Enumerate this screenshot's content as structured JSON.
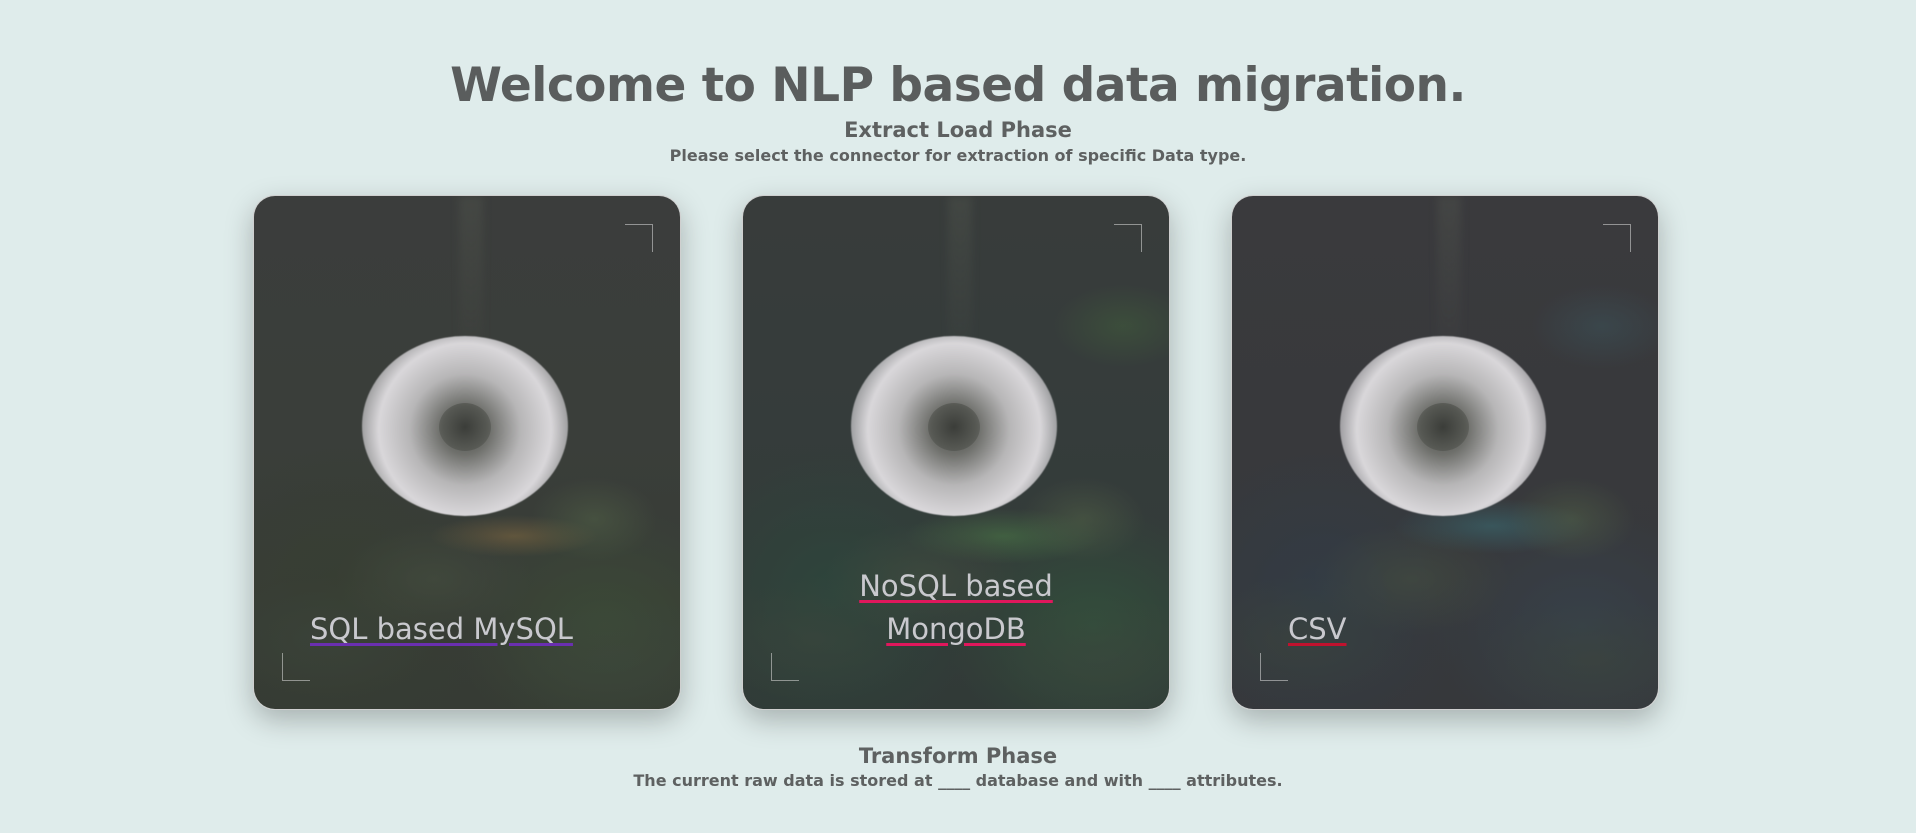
{
  "header": {
    "title": "Welcome to NLP based data migration."
  },
  "extract_phase": {
    "title": "Extract Load Phase",
    "subtitle": "Please select the connector for extraction of specific Data type."
  },
  "connectors": [
    {
      "label": "SQL based MySQL",
      "accent": "#6a2fb0"
    },
    {
      "label": "NoSQL based MongoDB",
      "accent": "#e0175c"
    },
    {
      "label": "CSV",
      "accent": "#c0122e"
    }
  ],
  "transform_phase": {
    "title": "Transform Phase",
    "subtitle": "The current raw data is stored at ____ database and with ____ attributes."
  },
  "colors": {
    "background": "#dfeceb",
    "text": "#5a5d5d"
  }
}
